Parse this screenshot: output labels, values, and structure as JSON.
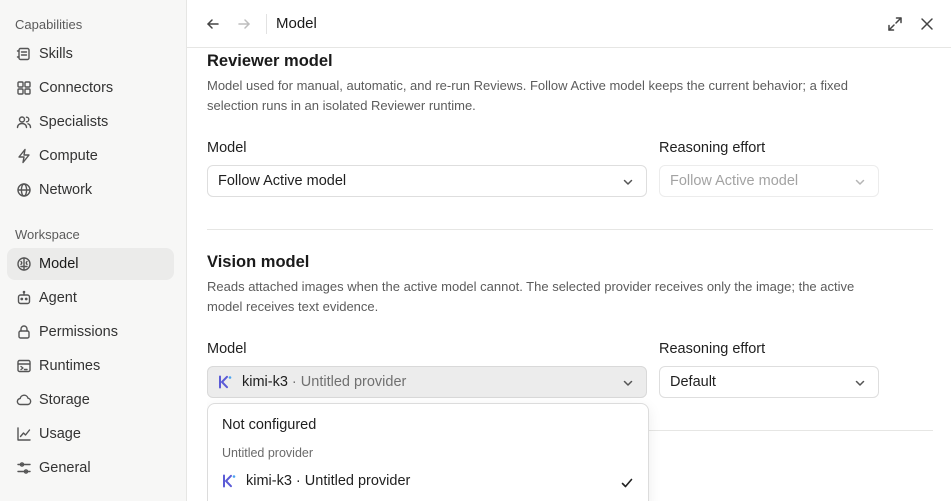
{
  "sidebar": {
    "capabilities_label": "Capabilities",
    "workspace_label": "Workspace",
    "capabilities": [
      {
        "label": "Skills",
        "icon": "skills-icon"
      },
      {
        "label": "Connectors",
        "icon": "connectors-icon"
      },
      {
        "label": "Specialists",
        "icon": "specialists-icon"
      },
      {
        "label": "Compute",
        "icon": "compute-icon"
      },
      {
        "label": "Network",
        "icon": "network-icon"
      }
    ],
    "workspace": [
      {
        "label": "Model",
        "icon": "model-icon",
        "active": true
      },
      {
        "label": "Agent",
        "icon": "agent-icon"
      },
      {
        "label": "Permissions",
        "icon": "lock-icon"
      },
      {
        "label": "Runtimes",
        "icon": "runtimes-icon"
      },
      {
        "label": "Storage",
        "icon": "cloud-icon"
      },
      {
        "label": "Usage",
        "icon": "chart-icon"
      },
      {
        "label": "General",
        "icon": "sliders-icon"
      }
    ]
  },
  "header": {
    "title": "Model"
  },
  "reviewer": {
    "title": "Reviewer model",
    "description": "Model used for manual, automatic, and re-run Reviews. Follow Active model keeps the current behavior; a fixed selection runs in an isolated Reviewer runtime.",
    "model_label": "Model",
    "model_value": "Follow Active model",
    "effort_label": "Reasoning effort",
    "effort_value": "Follow Active model"
  },
  "vision": {
    "title": "Vision model",
    "description": "Reads attached images when the active model cannot. The selected provider receives only the image; the active model receives text evidence.",
    "model_label": "Model",
    "model_name": "kimi-k3",
    "model_provider": "· Untitled provider",
    "effort_label": "Reasoning effort",
    "effort_value": "Default"
  },
  "dropdown": {
    "not_configured": "Not configured",
    "group_label": "Untitled provider",
    "option_name": "kimi-k3",
    "option_provider": "· Untitled provider"
  },
  "colors": {
    "accent_k": "#5b5bd6",
    "active_bg": "#ebebea"
  }
}
